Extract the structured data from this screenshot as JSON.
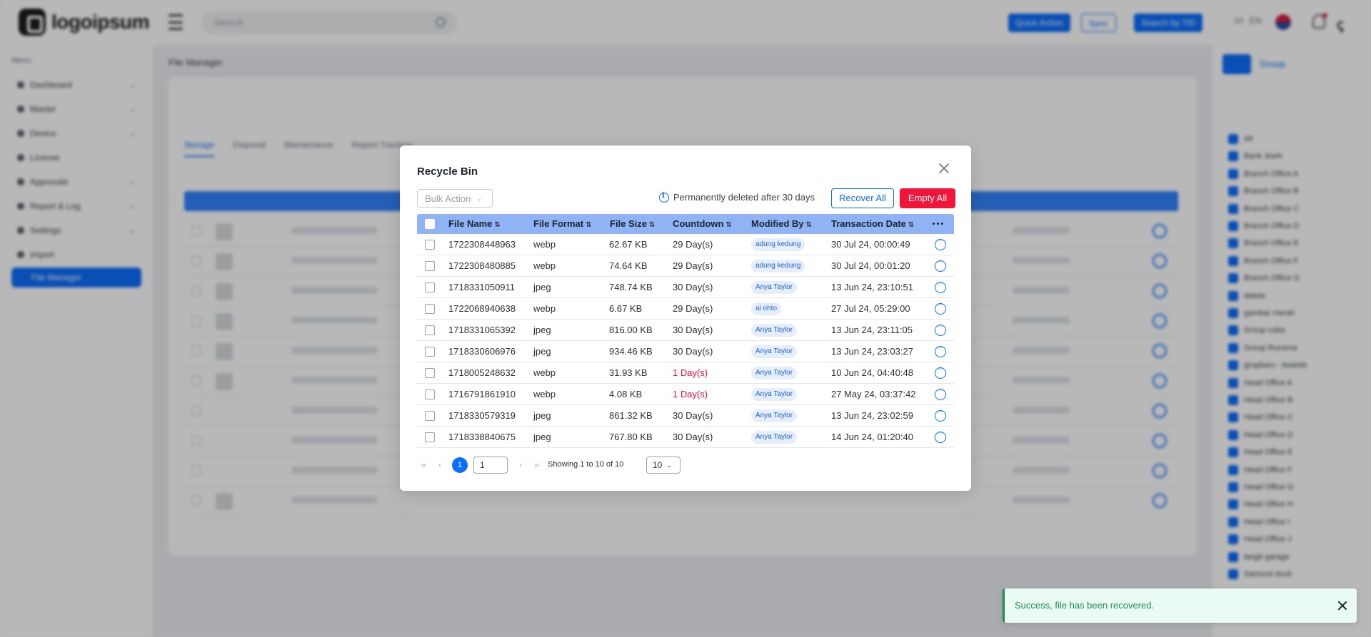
{
  "header": {
    "logo_text": "logoipsum",
    "search_placeholder": "Search",
    "buttons": [
      "Quick Action",
      "Sync",
      "Search by TID"
    ],
    "misc": [
      "10",
      "EN"
    ]
  },
  "sidebar": {
    "menu_title": "Menu",
    "items": [
      {
        "label": "Dashboard"
      },
      {
        "label": "Master"
      },
      {
        "label": "Device"
      },
      {
        "label": "License"
      },
      {
        "label": "Approvals"
      },
      {
        "label": "Report & Log"
      },
      {
        "label": "Settings"
      },
      {
        "label": "Import"
      },
      {
        "label": "File Manager",
        "active": true
      }
    ]
  },
  "background": {
    "page_title": "File Manager",
    "tabs": [
      "Storage",
      "Disposal",
      "Maintenance",
      "Report Tracking"
    ],
    "right_panel_title": "Group",
    "right_items": [
      "All",
      "Bank Jowh",
      "Branch Office A",
      "Branch Office B",
      "Branch Office C",
      "Branch Office D",
      "Branch Office E",
      "Branch Office F",
      "Branch Office G",
      "delete",
      "gambar merah",
      "Group coba",
      "Group Rucema",
      "grupbaru - keaiste",
      "Head Office A",
      "Head Office B",
      "Head Office C",
      "Head Office D",
      "Head Office E",
      "Head Office F",
      "Head Office G",
      "Head Office H",
      "Head Office I",
      "Head Office J",
      "langit garage",
      "Samurai duck"
    ]
  },
  "modal": {
    "title": "Recycle Bin",
    "bulk_action": "Bulk Action",
    "info_text": "Permanently deleted after 30 days",
    "recover_all": "Recover All",
    "empty_all": "Empty All",
    "columns": [
      "File Name",
      "File Format",
      "File Size",
      "Countdown",
      "Modified By",
      "Transaction Date"
    ],
    "rows": [
      {
        "file_name": "1722308448963",
        "format": "webp",
        "size": "62.67 KB",
        "countdown": "29 Day(s)",
        "modified_by": "adung kedung",
        "date": "30 Jul 24, 00:00:49",
        "urgent": false
      },
      {
        "file_name": "1722308480885",
        "format": "webp",
        "size": "74.64 KB",
        "countdown": "29 Day(s)",
        "modified_by": "adung kedung",
        "date": "30 Jul 24, 00:01:20",
        "urgent": false
      },
      {
        "file_name": "1718331050911",
        "format": "jpeg",
        "size": "748.74 KB",
        "countdown": "30 Day(s)",
        "modified_by": "Anya Taylor",
        "date": "13 Jun 24, 23:10:51",
        "urgent": false
      },
      {
        "file_name": "1722068940638",
        "format": "webp",
        "size": "6.67 KB",
        "countdown": "29 Day(s)",
        "modified_by": "ai ohto",
        "date": "27 Jul 24, 05:29:00",
        "urgent": false
      },
      {
        "file_name": "1718331065392",
        "format": "jpeg",
        "size": "816.00 KB",
        "countdown": "30 Day(s)",
        "modified_by": "Anya Taylor",
        "date": "13 Jun 24, 23:11:05",
        "urgent": false
      },
      {
        "file_name": "1718330606976",
        "format": "jpeg",
        "size": "934.46 KB",
        "countdown": "30 Day(s)",
        "modified_by": "Anya Taylor",
        "date": "13 Jun 24, 23:03:27",
        "urgent": false
      },
      {
        "file_name": "1718005248632",
        "format": "webp",
        "size": "31.93 KB",
        "countdown": "1 Day(s)",
        "modified_by": "Anya Taylor",
        "date": "10 Jun 24, 04:40:48",
        "urgent": true
      },
      {
        "file_name": "1716791861910",
        "format": "webp",
        "size": "4.08 KB",
        "countdown": "1 Day(s)",
        "modified_by": "Anya Taylor",
        "date": "27 May 24, 03:37:42",
        "urgent": true
      },
      {
        "file_name": "1718330579319",
        "format": "jpeg",
        "size": "861.32 KB",
        "countdown": "30 Day(s)",
        "modified_by": "Anya Taylor",
        "date": "13 Jun 24, 23:02:59",
        "urgent": false
      },
      {
        "file_name": "1718338840675",
        "format": "jpeg",
        "size": "767.80 KB",
        "countdown": "30 Day(s)",
        "modified_by": "Anya Taylor",
        "date": "14 Jun 24, 01:20:40",
        "urgent": false
      }
    ],
    "pagination": {
      "current_page": "1",
      "page_input": "1",
      "showing_text": "Showing 1 to 10 of 10",
      "page_size": "10"
    }
  },
  "toast": {
    "message": "Success, file has been recovered."
  },
  "colors": {
    "primary": "#0d6efd",
    "danger": "#f3143a",
    "header_row": "#8fb3f5",
    "success": "#1a8f55"
  }
}
